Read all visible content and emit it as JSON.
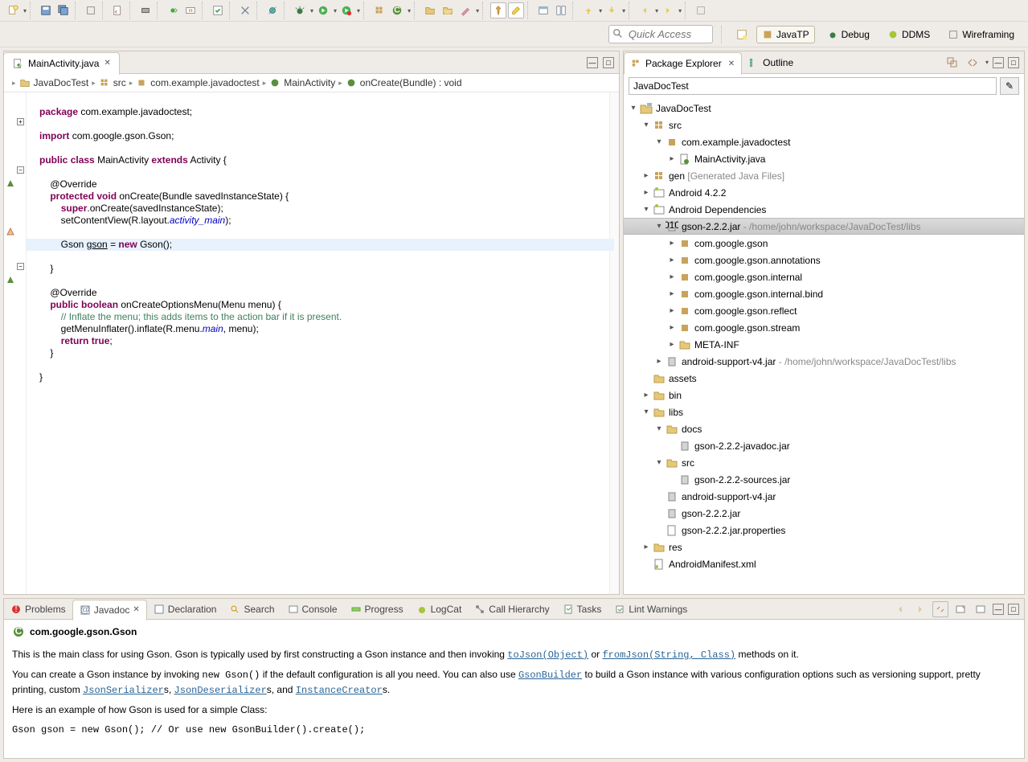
{
  "quick_access_placeholder": "Quick Access",
  "perspectives": [
    {
      "label": "JavaTP",
      "active": true
    },
    {
      "label": "Debug",
      "active": false
    },
    {
      "label": "DDMS",
      "active": false
    },
    {
      "label": "Wireframing",
      "active": false
    }
  ],
  "editor": {
    "tab_label": "MainActivity.java",
    "breadcrumbs": [
      "JavaDocTest",
      "src",
      "com.example.javadoctest",
      "MainActivity",
      "onCreate(Bundle) : void"
    ]
  },
  "code": {
    "l1": "package com.example.javadoctest;",
    "l2": "import com.google.gson.Gson;",
    "l3": "public class MainActivity extends Activity {",
    "l4": "    @Override",
    "l5": "    protected void onCreate(Bundle savedInstanceState) {",
    "l6": "        super.onCreate(savedInstanceState);",
    "l7": "        setContentView(R.layout.activity_main);",
    "l8": "        Gson gson = new Gson();",
    "l9": "    }",
    "l10": "    @Override",
    "l11": "    public boolean onCreateOptionsMenu(Menu menu) {",
    "l12": "        // Inflate the menu; this adds items to the action bar if it is present.",
    "l13": "        getMenuInflater().inflate(R.menu.main, menu);",
    "l14": "        return true;",
    "l15": "    }",
    "l16": "}"
  },
  "right_tabs": {
    "package_explorer": "Package Explorer",
    "outline": "Outline"
  },
  "pe_filter_value": "JavaDocTest",
  "tree": {
    "project": "JavaDocTest",
    "src": "src",
    "pkg": "com.example.javadoctest",
    "main_java": "MainActivity.java",
    "gen": "gen",
    "gen_hint": "[Generated Java Files]",
    "android": "Android 4.2.2",
    "deps": "Android Dependencies",
    "gson_jar": "gson-2.2.2.jar",
    "gson_path": " - /home/john/workspace/JavaDocTest/libs",
    "pkg1": "com.google.gson",
    "pkg2": "com.google.gson.annotations",
    "pkg3": "com.google.gson.internal",
    "pkg4": "com.google.gson.internal.bind",
    "pkg5": "com.google.gson.reflect",
    "pkg6": "com.google.gson.stream",
    "meta": "META-INF",
    "support": "android-support-v4.jar",
    "support_path": " - /home/john/workspace/JavaDocTest/libs",
    "assets": "assets",
    "bin": "bin",
    "libs": "libs",
    "docs": "docs",
    "javadoc_jar": "gson-2.2.2-javadoc.jar",
    "libs_src": "src",
    "sources_jar": "gson-2.2.2-sources.jar",
    "support2": "android-support-v4.jar",
    "gson2": "gson-2.2.2.jar",
    "gson_props": "gson-2.2.2.jar.properties",
    "res": "res",
    "manifest": "AndroidManifest.xml"
  },
  "bottom_tabs": [
    "Problems",
    "Javadoc",
    "Declaration",
    "Search",
    "Console",
    "Progress",
    "LogCat",
    "Call Hierarchy",
    "Tasks",
    "Lint Warnings"
  ],
  "javadoc": {
    "title": "com.google.gson.Gson",
    "p1a": "This is the main class for using Gson. Gson is typically used by first constructing a Gson instance and then invoking ",
    "link1": "toJson(Object)",
    "p1b": " or ",
    "link2": "fromJson(String, Class)",
    "p1c": " methods on it.",
    "p2a": "You can create a Gson instance by invoking ",
    "code2": "new Gson()",
    "p2b": " if the default configuration is all you need. You can also use ",
    "link3": "GsonBuilder",
    "p2c": " to build a Gson instance with various configuration options such as versioning support, pretty printing, custom ",
    "link4": "JsonSerializer",
    "p2d": "s, ",
    "link5": "JsonDeserializer",
    "p2e": "s, and ",
    "link6": "InstanceCreator",
    "p2f": "s.",
    "p3": "Here is an example of how Gson is used for a simple Class:",
    "code3": "Gson gson = new Gson(); // Or use new GsonBuilder().create();"
  }
}
